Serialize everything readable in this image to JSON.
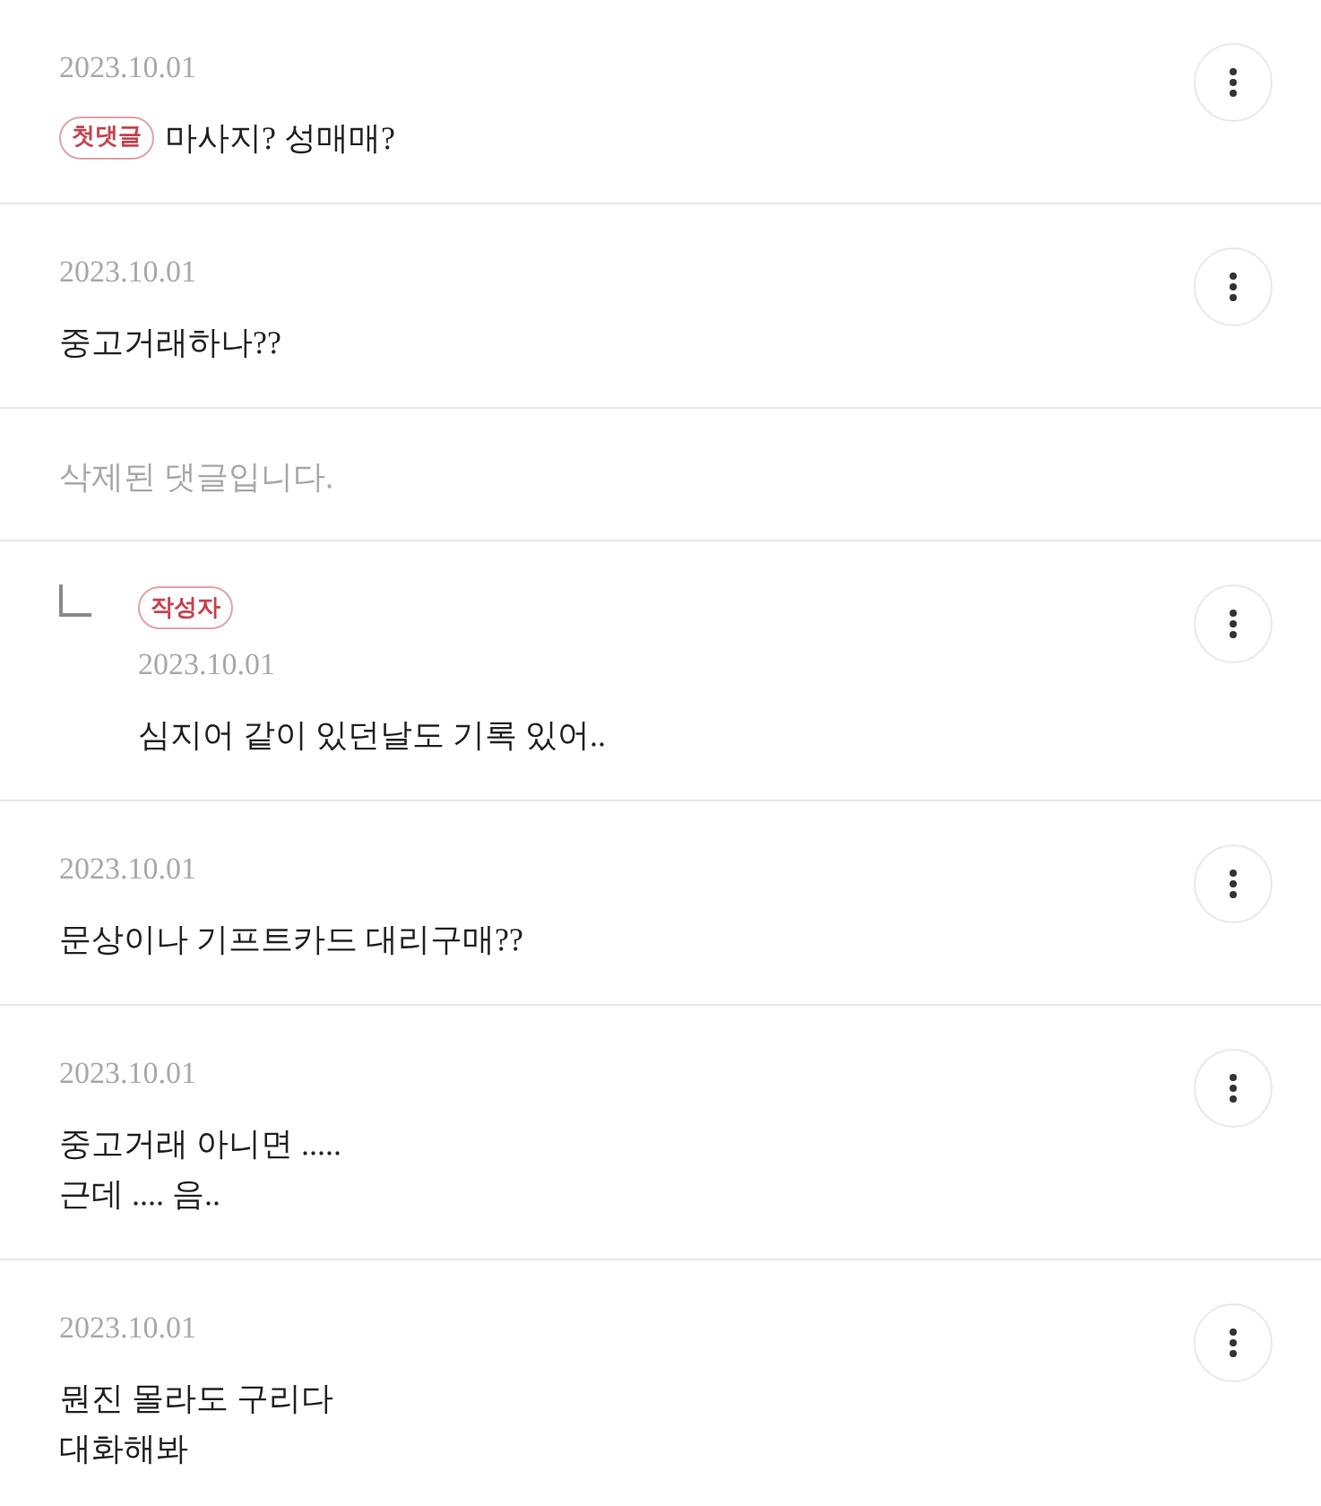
{
  "comments": [
    {
      "kind": "comment",
      "date": "2023.10.01",
      "badge": "첫댓글",
      "text": "마사지? 성매매?"
    },
    {
      "kind": "comment",
      "date": "2023.10.01",
      "text": "중고거래하나??"
    },
    {
      "kind": "deleted",
      "text": "삭제된 댓글입니다."
    },
    {
      "kind": "reply",
      "badge": "작성자",
      "date": "2023.10.01",
      "text": "심지어 같이 있던날도 기록 있어.."
    },
    {
      "kind": "comment",
      "date": "2023.10.01",
      "text": "문상이나 기프트카드 대리구매??"
    },
    {
      "kind": "comment",
      "date": "2023.10.01",
      "text": "중고거래 아니면 .....\n근데 .... 음.."
    },
    {
      "kind": "comment",
      "date": "2023.10.01",
      "text": "뭔진 몰라도 구리다\n대화해봐"
    }
  ]
}
